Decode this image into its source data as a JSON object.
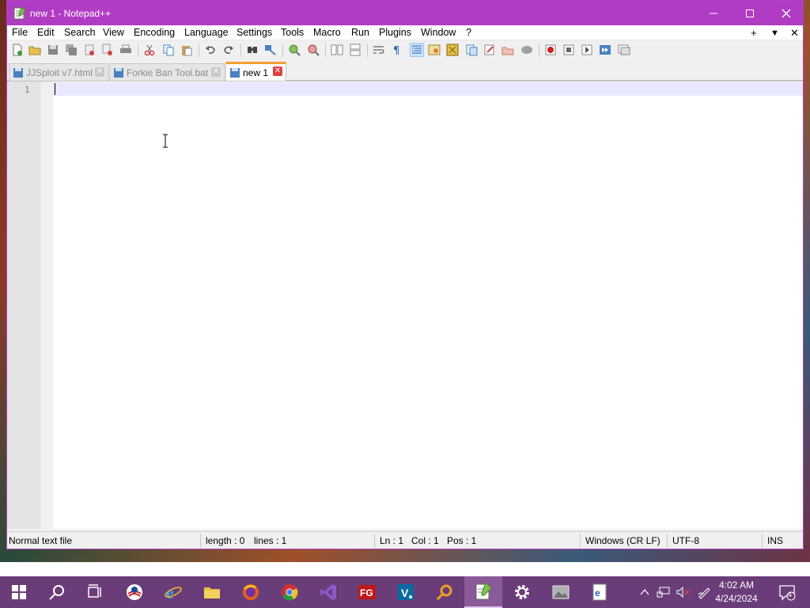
{
  "window": {
    "title": "new 1 - Notepad++",
    "controls": {
      "minimize": "—",
      "maximize": "☐",
      "close": "✕"
    }
  },
  "menu": {
    "items": [
      "File",
      "Edit",
      "Search",
      "View",
      "Encoding",
      "Language",
      "Settings",
      "Tools",
      "Macro",
      "Run",
      "Plugins",
      "Window",
      "?"
    ],
    "right": {
      "add": "+",
      "dropdown": "▼",
      "close": "✕"
    }
  },
  "toolbar": {
    "icons": [
      "new-file-icon",
      "open-file-icon",
      "save-icon",
      "save-all-icon",
      "close-icon",
      "close-all-icon",
      "print-icon",
      "cut-icon",
      "copy-icon",
      "paste-icon",
      "undo-icon",
      "redo-icon",
      "find-icon",
      "replace-icon",
      "zoom-in-icon",
      "zoom-out-icon",
      "sync-vertical-icon",
      "sync-horizontal-icon",
      "word-wrap-icon",
      "show-all-chars-icon",
      "indent-guide-icon",
      "user-language-icon",
      "doc-map-icon",
      "function-list-icon",
      "folder-workspace-icon",
      "monitoring-icon",
      "start-recording-icon",
      "stop-recording-icon",
      "playback-icon",
      "run-macro-multiple-icon",
      "save-macro-icon"
    ]
  },
  "tabs": [
    {
      "label": "JJSploit v7.html",
      "active": false
    },
    {
      "label": "Forkie Ban Tool.bat",
      "active": false
    },
    {
      "label": "new 1",
      "active": true
    }
  ],
  "editor": {
    "line_number": "1"
  },
  "status": {
    "file_type": "Normal text file",
    "length": "length : 0",
    "lines": "lines : 1",
    "ln": "Ln : 1",
    "col": "Col : 1",
    "pos": "Pos : 1",
    "eol": "Windows (CR LF)",
    "encoding": "UTF-8",
    "mode": "INS"
  },
  "taskbar": {
    "time": "4:02 AM",
    "date": "4/24/2024",
    "notification_count": "4"
  },
  "colors": {
    "titlebar": "#b03cc4",
    "taskbar": "#6a3d7a",
    "active_tab_accent": "#f0a030"
  }
}
